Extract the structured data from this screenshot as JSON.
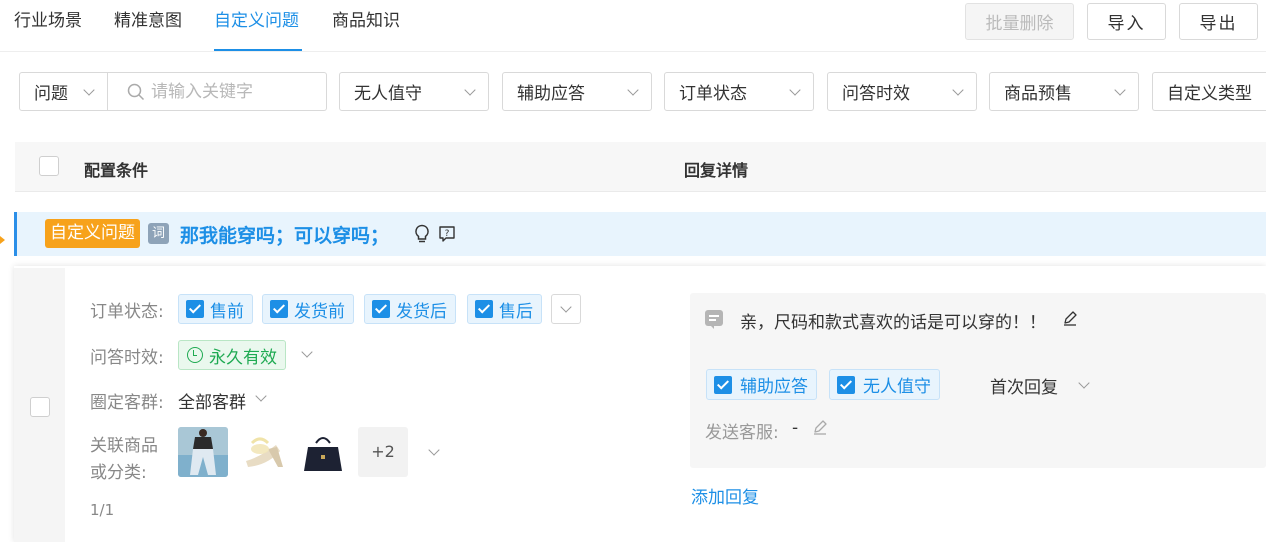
{
  "tabs": [
    {
      "label": "行业场景",
      "active": false
    },
    {
      "label": "精准意图",
      "active": false
    },
    {
      "label": "自定义问题",
      "active": true
    },
    {
      "label": "商品知识",
      "active": false
    }
  ],
  "toolbar": {
    "batch_delete": "批量删除",
    "import": "导入",
    "export": "导出"
  },
  "filters": {
    "type_select": "问题",
    "search_placeholder": "请输入关键字",
    "dropdowns": [
      "无人值守",
      "辅助应答",
      "订单状态",
      "问答时效",
      "商品预售",
      "自定义类型"
    ]
  },
  "table": {
    "col_config": "配置条件",
    "col_reply": "回复详情"
  },
  "group": {
    "tag": "自定义问题",
    "word_badge": "词",
    "title": "那我能穿吗；可以穿吗；"
  },
  "record": {
    "order_status_label": "订单状态:",
    "order_status_options": [
      "售前",
      "发货前",
      "发货后",
      "售后"
    ],
    "validity_label": "问答时效:",
    "validity_value": "永久有效",
    "customer_group_label": "圈定客群:",
    "customer_group_value": "全部客群",
    "linked_label_line1": "关联商品",
    "linked_label_line2": "或分类:",
    "more_count": "+2",
    "pagination": "1/1"
  },
  "reply": {
    "text": "亲，尺码和款式喜欢的话是可以穿的！！",
    "modes": [
      "辅助应答",
      "无人值守"
    ],
    "reply_type": "首次回复",
    "sender_label": "发送客服:",
    "sender_value": "-",
    "add_reply": "添加回复"
  },
  "colors": {
    "accent": "#1d8fe6",
    "orange": "#f7a21b",
    "green": "#1faa52"
  }
}
